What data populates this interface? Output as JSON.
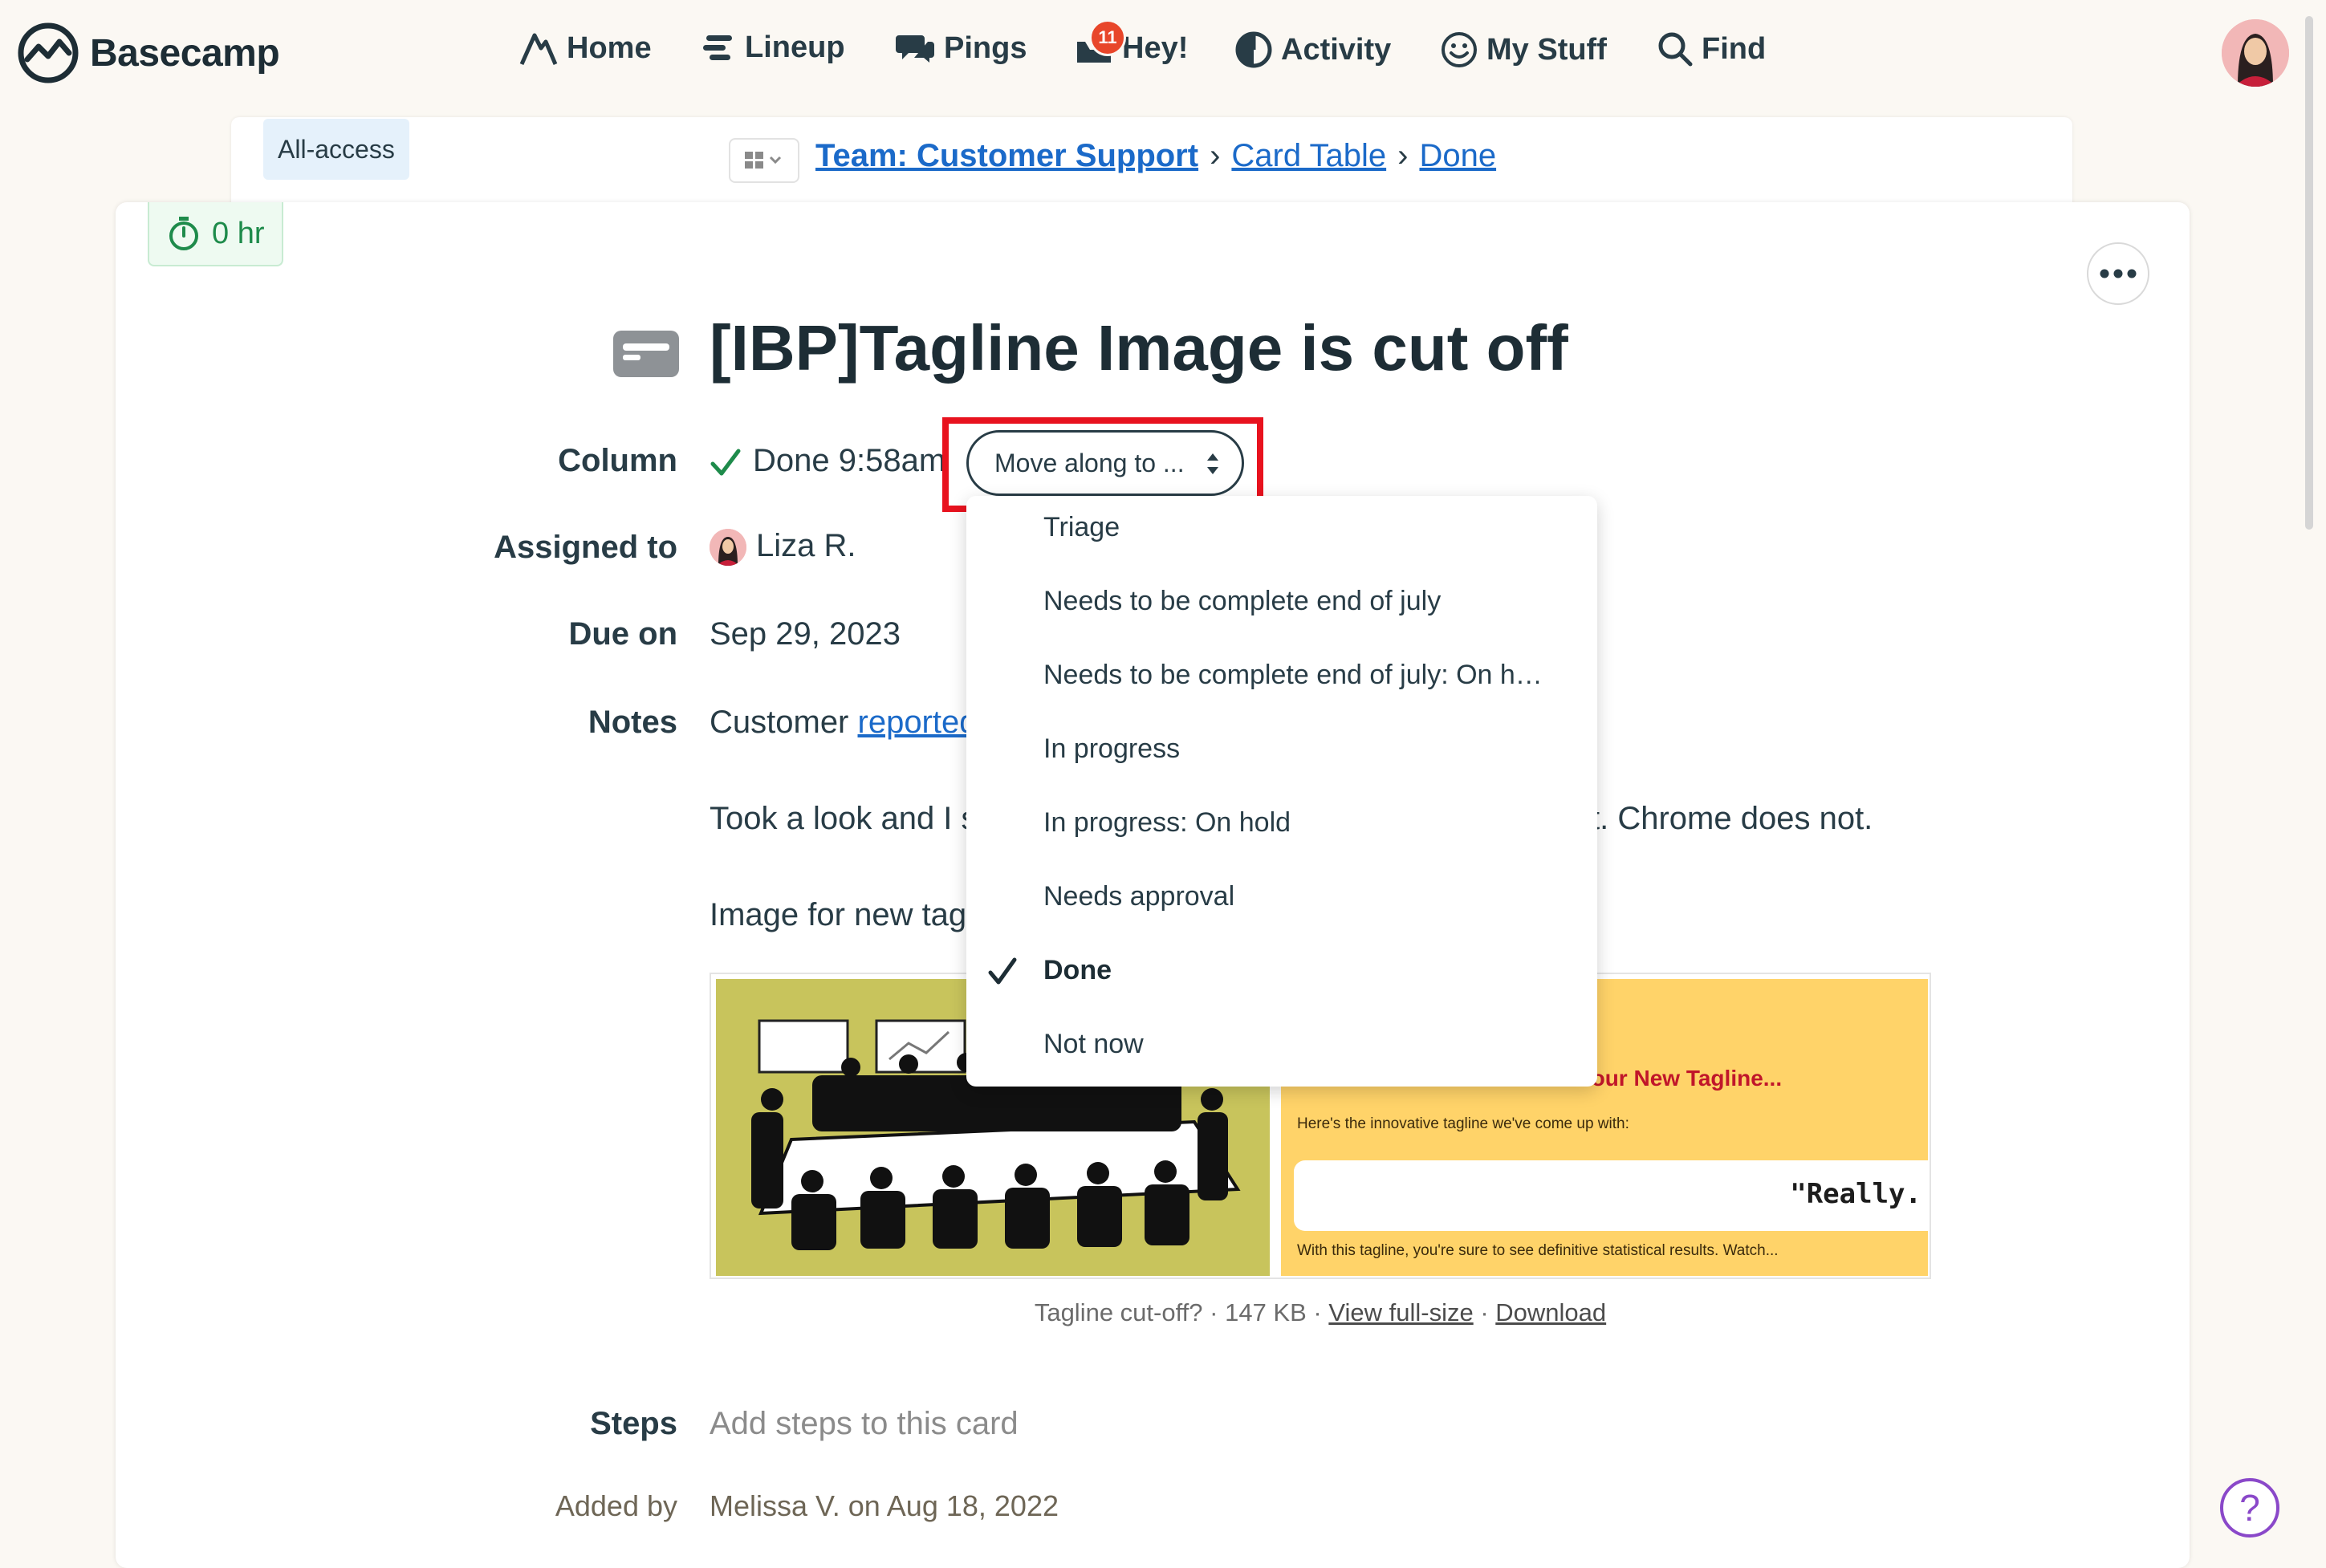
{
  "app": {
    "name": "Basecamp"
  },
  "nav": {
    "items": [
      {
        "label": "Home",
        "icon": "mountain-icon"
      },
      {
        "label": "Lineup",
        "icon": "lineup-icon"
      },
      {
        "label": "Pings",
        "icon": "chat-bubbles-icon"
      },
      {
        "label": "Hey!",
        "icon": "inbox-icon",
        "badge": "11"
      },
      {
        "label": "Activity",
        "icon": "activity-icon"
      },
      {
        "label": "My Stuff",
        "icon": "smiley-icon"
      },
      {
        "label": "Find",
        "icon": "search-icon"
      }
    ]
  },
  "breadcrumb": {
    "all_access": "All-access",
    "items": [
      "Team: Customer Support",
      "Card Table",
      "Done"
    ],
    "separator": "›"
  },
  "card": {
    "timer": "0 hr",
    "title": "[IBP]Tagline Image is cut off",
    "fields": {
      "column_label": "Column",
      "column_value": "Done 9:58am",
      "assigned_label": "Assigned to",
      "assigned_value": "Liza R.",
      "due_label": "Due on",
      "due_value": "Sep 29, 2023",
      "notes_label": "Notes",
      "notes_line1_prefix": "Customer ",
      "notes_line1_link": "reported",
      "notes_line1_suffix": ".",
      "notes_line2_prefix": "Took a look and I s",
      "notes_line2_suffix": "t. Chrome does not.",
      "notes_line3": "Image for new tag",
      "steps_label": "Steps",
      "steps_placeholder": "Add steps to this card",
      "added_label": "Added by",
      "added_value": "Melissa V. on Aug 18, 2022"
    },
    "move_select": {
      "label": "Move along to ..."
    },
    "attachment": {
      "headline": "Your New Tagline...",
      "subline": "Here's the innovative tagline we've come up with:",
      "quote": "\"Really.",
      "footer": "With this tagline, you're sure to see definitive statistical results. Watch...",
      "caption_name": "Tagline cut-off?",
      "caption_size": "147 KB",
      "caption_dot": "·",
      "view_full": "View full-size",
      "download": "Download"
    }
  },
  "dropdown": {
    "options": [
      "Triage",
      "Needs to be complete end of july",
      "Needs to be complete end of july: On h…",
      "In progress",
      "In progress: On hold",
      "Needs approval",
      "Done",
      "Not now"
    ],
    "selected": "Done"
  },
  "help": {
    "label": "?"
  },
  "colors": {
    "link": "#1b6ac9",
    "highlight": "#e8121e",
    "badge": "#e8462a",
    "timer": "#1e8b4b",
    "help": "#8a48c9"
  }
}
